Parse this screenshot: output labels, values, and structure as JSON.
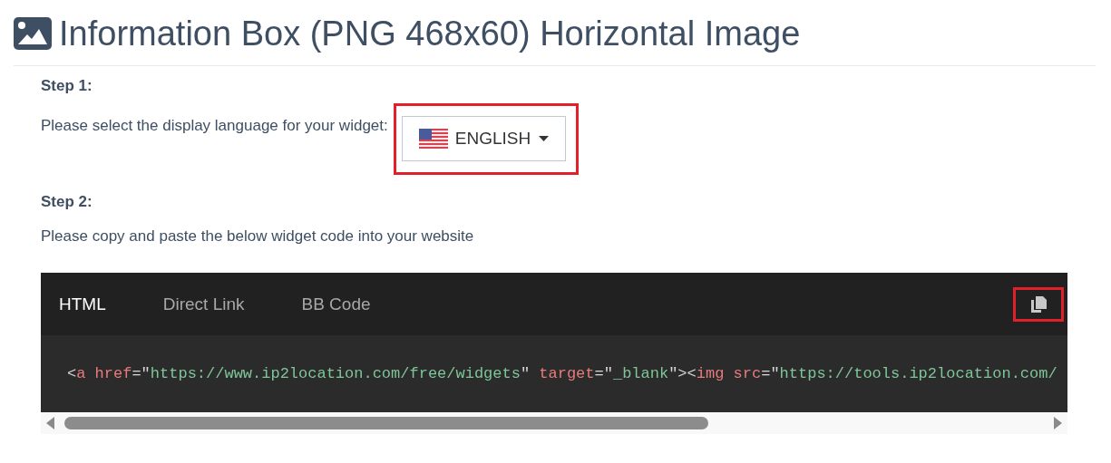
{
  "heading": {
    "title": "Information Box (PNG 468x60) Horizontal Image"
  },
  "steps": [
    {
      "kind": "language",
      "label": "Step 1:",
      "text": "Please select the display language for your widget:",
      "language": {
        "label": "ENGLISH",
        "highlighted": true
      }
    },
    {
      "kind": "code",
      "label": "Step 2:",
      "text": "Please copy and paste the below widget code into your website"
    }
  ],
  "code_panel": {
    "tabs": [
      {
        "label": "HTML",
        "selected": true
      },
      {
        "label": "Direct Link",
        "selected": false
      },
      {
        "label": "BB Code",
        "selected": false
      }
    ],
    "copy_button": {
      "highlighted": true
    },
    "code": [
      {
        "kind": "punct",
        "text": "<"
      },
      {
        "kind": "tag",
        "text": "a"
      },
      {
        "kind": "attr",
        "text": " href"
      },
      {
        "kind": "punct",
        "text": "=\""
      },
      {
        "kind": "string",
        "text": "https://www.ip2location.com/free/widgets"
      },
      {
        "kind": "punct",
        "text": "\" "
      },
      {
        "kind": "attr",
        "text": "target"
      },
      {
        "kind": "punct",
        "text": "=\""
      },
      {
        "kind": "string",
        "text": "_blank"
      },
      {
        "kind": "punct",
        "text": "\"><"
      },
      {
        "kind": "tag",
        "text": "img"
      },
      {
        "kind": "attr",
        "text": " src"
      },
      {
        "kind": "punct",
        "text": "=\""
      },
      {
        "kind": "string",
        "text": "https://tools.ip2location.com/"
      }
    ]
  }
}
